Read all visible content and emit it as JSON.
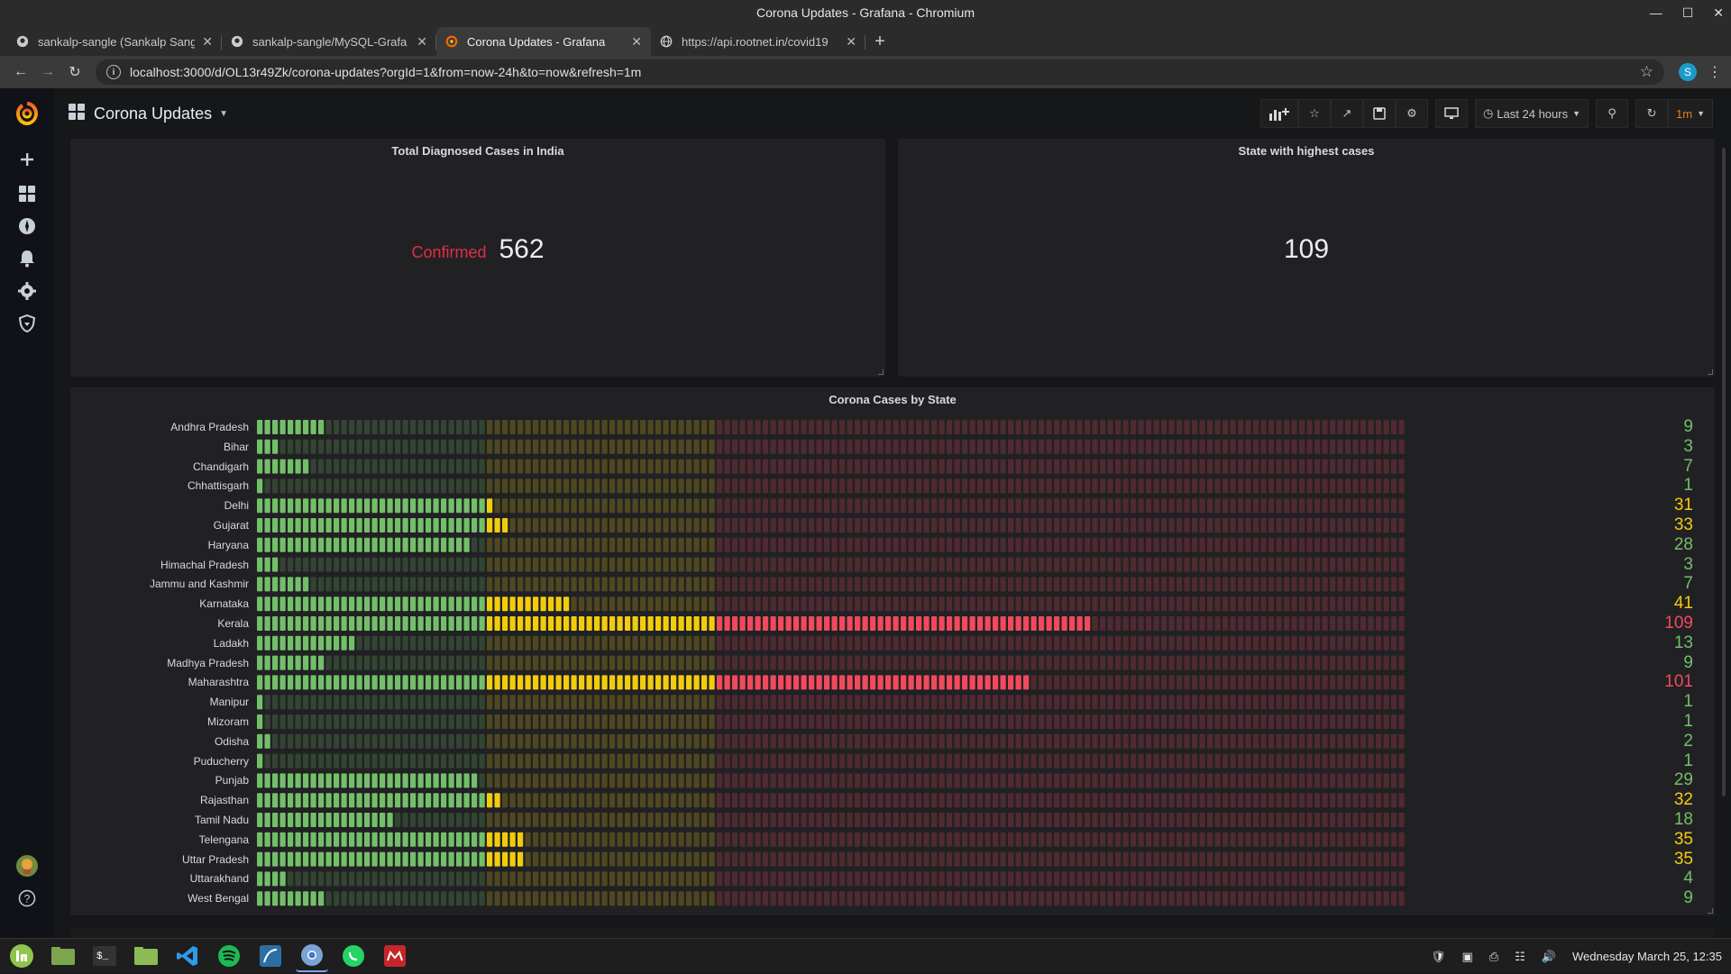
{
  "window": {
    "title": "Corona Updates - Grafana - Chromium"
  },
  "tabs": [
    {
      "title": "sankalp-sangle (Sankalp Sang",
      "icon": "github-icon",
      "active": false
    },
    {
      "title": "sankalp-sangle/MySQL-Grafa",
      "icon": "github-icon",
      "active": false
    },
    {
      "title": "Corona Updates - Grafana",
      "icon": "grafana-icon",
      "active": true
    },
    {
      "title": "https://api.rootnet.in/covid19",
      "icon": "globe-icon",
      "active": false
    }
  ],
  "toolbar": {
    "url": "localhost:3000/d/OL13r49Zk/corona-updates?orgId=1&from=now-24h&to=now&refresh=1m",
    "profile_initial": "S"
  },
  "dashboard": {
    "title": "Corona Updates",
    "time_range": "Last 24 hours",
    "refresh": "1m"
  },
  "panels": {
    "total": {
      "title": "Total Diagnosed Cases in India",
      "prefix": "Confirmed",
      "value": "562"
    },
    "highest": {
      "title": "State with highest cases",
      "value": "109"
    },
    "bargauge": {
      "title": "Corona Cases by State"
    }
  },
  "chart_data": {
    "type": "bar",
    "orientation": "horizontal",
    "display": "lcd-gauge",
    "title": "Corona Cases by State",
    "xlim": [
      0,
      150
    ],
    "thresholds": [
      {
        "from": 0,
        "color": "#73bf69"
      },
      {
        "from": 30,
        "color": "#f2cc0c"
      },
      {
        "from": 60,
        "color": "#f2495c"
      }
    ],
    "categories": [
      "Andhra Pradesh",
      "Bihar",
      "Chandigarh",
      "Chhattisgarh",
      "Delhi",
      "Gujarat",
      "Haryana",
      "Himachal Pradesh",
      "Jammu and Kashmir",
      "Karnataka",
      "Kerala",
      "Ladakh",
      "Madhya Pradesh",
      "Maharashtra",
      "Manipur",
      "Mizoram",
      "Odisha",
      "Puducherry",
      "Punjab",
      "Rajasthan",
      "Tamil Nadu",
      "Telengana",
      "Uttar Pradesh",
      "Uttarakhand",
      "West Bengal"
    ],
    "values": [
      9,
      3,
      7,
      1,
      31,
      33,
      28,
      3,
      7,
      41,
      109,
      13,
      9,
      101,
      1,
      1,
      2,
      1,
      29,
      32,
      18,
      35,
      35,
      4,
      9
    ]
  },
  "taskbar": {
    "clock": "Wednesday March 25, 12:35"
  }
}
